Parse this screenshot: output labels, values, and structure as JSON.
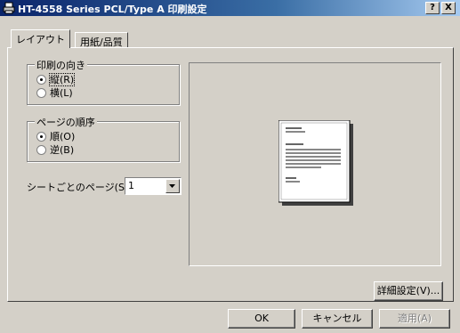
{
  "window": {
    "title": "HT-4558 Series PCL/Type A 印刷設定",
    "help_label": "?",
    "close_label": "X"
  },
  "tabs": [
    {
      "label": "レイアウト",
      "selected": true
    },
    {
      "label": "用紙/品質",
      "selected": false
    }
  ],
  "orientation": {
    "label": "印刷の向き",
    "options": [
      {
        "label": "縦(R)",
        "checked": true
      },
      {
        "label": "横(L)",
        "checked": false
      }
    ]
  },
  "page_order": {
    "label": "ページの順序",
    "options": [
      {
        "label": "順(O)",
        "checked": true
      },
      {
        "label": "逆(B)",
        "checked": false
      }
    ]
  },
  "pages_per_sheet": {
    "label": "シートごとのページ(S):",
    "value": "1"
  },
  "buttons": {
    "advanced": "詳細設定(V)...",
    "ok": "OK",
    "cancel": "キャンセル",
    "apply": "適用(A)"
  }
}
